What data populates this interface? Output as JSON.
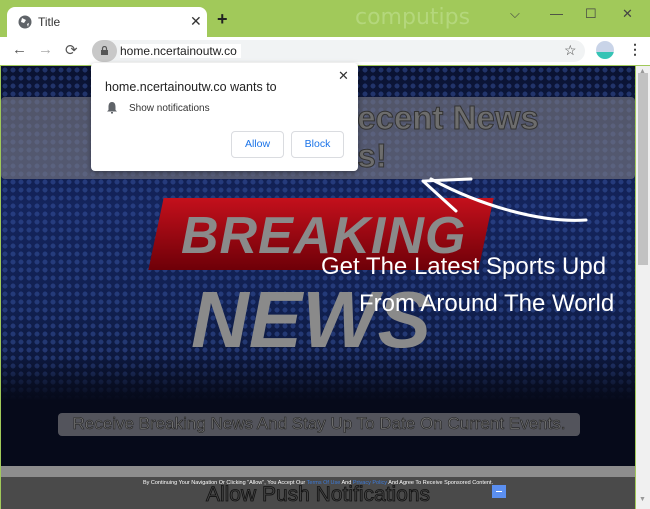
{
  "browser": {
    "tab_title": "Title",
    "tab_close": "✕",
    "new_tab": "+",
    "watermark": "computips",
    "window_controls": {
      "dropdown": "⌵",
      "minimize": "—",
      "maximize": "☐",
      "close": "✕"
    },
    "nav": {
      "back": "←",
      "forward": "→",
      "reload": "⟳"
    },
    "url": "home.ncertainoutw.co",
    "bookmark_star": "☆",
    "menu": "⋮"
  },
  "popup": {
    "title": "home.ncertainoutw.co wants to",
    "permission": "Show notifications",
    "allow_label": "Allow",
    "block_label": "Block",
    "close": "✕"
  },
  "page": {
    "headline": "Click Allow To Get Recent News Updates!",
    "headline_visible_line1": "ecent News",
    "headline_visible_line2": "es!",
    "breaking": "BREAKING",
    "news": "NEWS",
    "sports_line1": "Get The Latest Sports Upd",
    "sports_line2": "From Around The World",
    "receive": "Receive Breaking News And Stay Up To Date On Current Events.",
    "footer": {
      "consent_prefix": "By Continuing Your Navigation Or Clicking \"Allow\", You Accept Our ",
      "terms_link": "Terms Of Use",
      "consent_and": " And ",
      "privacy_link": "Privacy Policy",
      "consent_suffix": " And Agree To Receive Sponsored Content.",
      "allow_push": "Allow Push Notifications"
    }
  },
  "scrollbar": {
    "up": "▲",
    "down": "▼",
    "position_fraction": 0.0
  },
  "colors": {
    "chrome_frame": "#a1c95a",
    "accent_blue": "#1a73e8",
    "breaking_red": "#c4101c",
    "footer_button": "#5b8ff0"
  }
}
